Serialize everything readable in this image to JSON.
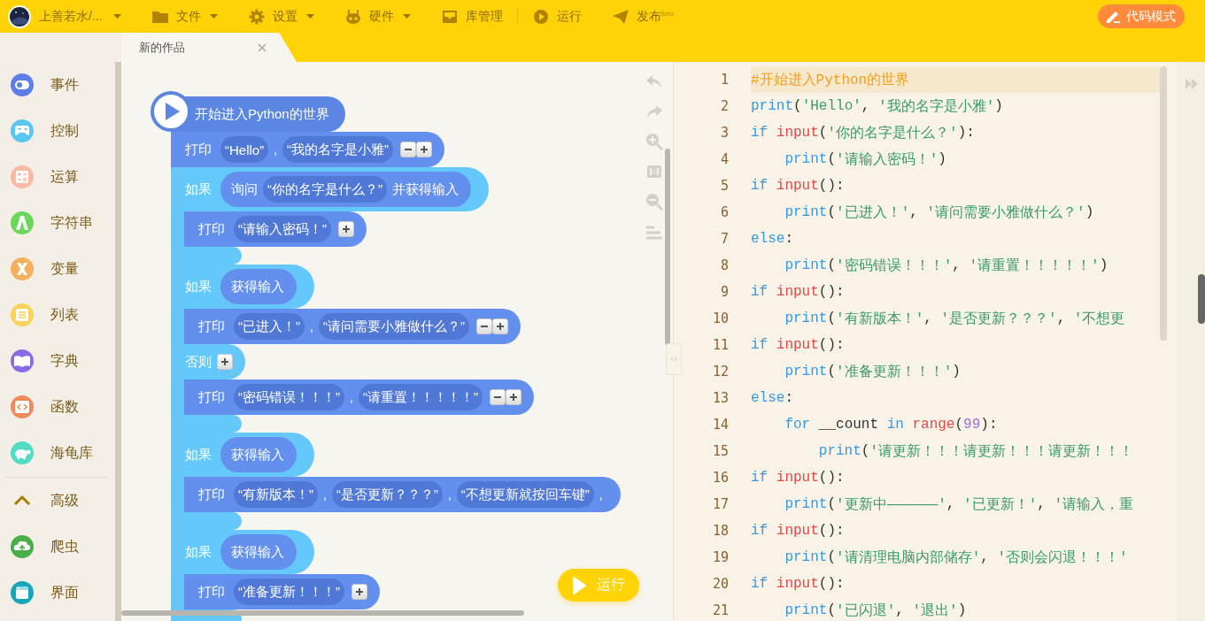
{
  "topbar": {
    "account": {
      "name": "上善若水/...",
      "has_menu": true
    },
    "menus": [
      {
        "label": "文件",
        "has_menu": true
      },
      {
        "label": "设置",
        "has_menu": true
      },
      {
        "label": "硬件",
        "has_menu": true
      },
      {
        "label": "库管理",
        "has_menu": false
      },
      {
        "label": "运行",
        "has_menu": false
      },
      {
        "label": "发布",
        "has_menu": false,
        "badge": "Beta"
      }
    ],
    "mode_button": "代码模式"
  },
  "tabs": [
    {
      "label": "新的作品",
      "selected": true
    }
  ],
  "sidebar": {
    "items": [
      {
        "label": "事件",
        "color": "#5b7fe6"
      },
      {
        "label": "控制",
        "color": "#5cc6f2"
      },
      {
        "label": "运算",
        "color": "#f9b9a2"
      },
      {
        "label": "字符串",
        "color": "#6cd85a"
      },
      {
        "label": "变量",
        "color": "#f4b05c"
      },
      {
        "label": "列表",
        "color": "#fbd25c"
      },
      {
        "label": "字典",
        "color": "#8a6be6"
      },
      {
        "label": "函数",
        "color": "#f0895a"
      },
      {
        "label": "海龟库",
        "color": "#4fdcc2"
      },
      {
        "label": "高级",
        "color": "#a67c00"
      },
      {
        "label": "爬虫",
        "color": "#4aae48"
      },
      {
        "label": "界面",
        "color": "#13a7b8"
      }
    ]
  },
  "blocks": {
    "start": "开始进入Python的世界",
    "stack": [
      {
        "kind": "print",
        "keyword": "打印",
        "args": [
          {
            "kind": "string",
            "text": "“Hello”"
          },
          {
            "kind": "sep",
            "text": ","
          },
          {
            "kind": "string",
            "text": "“我的名字是小雅”"
          }
        ],
        "can_remove": true,
        "can_add": true
      },
      {
        "kind": "if",
        "keyword": "如果",
        "condition": [
          {
            "kind": "label",
            "text": "询问"
          },
          {
            "kind": "string",
            "text": "“你的名字是什么？”"
          },
          {
            "kind": "label",
            "text": "并获得输入"
          }
        ],
        "body": [
          {
            "kind": "print",
            "keyword": "打印",
            "args": [
              {
                "kind": "string",
                "text": "“请输入密码！”"
              }
            ],
            "can_remove": false,
            "can_add": true
          }
        ]
      },
      {
        "kind": "if",
        "keyword": "如果",
        "condition": [
          {
            "kind": "label",
            "text": "获得输入"
          }
        ],
        "body": [
          {
            "kind": "print",
            "keyword": "打印",
            "args": [
              {
                "kind": "string",
                "text": "“已进入！”"
              },
              {
                "kind": "sep",
                "text": ","
              },
              {
                "kind": "string",
                "text": "“请问需要小雅做什么？”"
              }
            ],
            "can_remove": true,
            "can_add": true
          }
        ],
        "else": {
          "keyword": "否则",
          "can_add": true,
          "body": [
            {
              "kind": "print",
              "keyword": "打印",
              "args": [
                {
                  "kind": "string",
                  "text": "“密码错误！！！”"
                },
                {
                  "kind": "sep",
                  "text": ","
                },
                {
                  "kind": "string",
                  "text": "“请重置！！！！！”"
                }
              ],
              "can_remove": true,
              "can_add": true
            }
          ]
        }
      },
      {
        "kind": "if",
        "keyword": "如果",
        "condition": [
          {
            "kind": "label",
            "text": "获得输入"
          }
        ],
        "body": [
          {
            "kind": "print",
            "keyword": "打印",
            "args": [
              {
                "kind": "string",
                "text": "“有新版本！”"
              },
              {
                "kind": "sep",
                "text": ","
              },
              {
                "kind": "string",
                "text": "“是否更新？？？”"
              },
              {
                "kind": "sep",
                "text": ","
              },
              {
                "kind": "string",
                "text": "“不想更新就按回车键”"
              },
              {
                "kind": "sep",
                "text": ","
              }
            ],
            "can_remove": false,
            "can_add": false
          }
        ]
      },
      {
        "kind": "if",
        "keyword": "如果",
        "condition": [
          {
            "kind": "label",
            "text": "获得输入"
          }
        ],
        "body": [
          {
            "kind": "print",
            "keyword": "打印",
            "args": [
              {
                "kind": "string",
                "text": "“准备更新！！！”"
              }
            ],
            "can_remove": false,
            "can_add": true
          }
        ]
      }
    ],
    "run_button": "运行"
  },
  "code": {
    "lines": [
      {
        "number": "1",
        "current": true,
        "tokens": [
          {
            "kind": "comment",
            "text": "#开始进入Python的世界"
          }
        ]
      },
      {
        "number": "2",
        "current": false,
        "tokens": [
          {
            "kind": "keyword",
            "text": "print"
          },
          {
            "kind": "plain",
            "text": "("
          },
          {
            "kind": "string",
            "text": "'Hello'"
          },
          {
            "kind": "plain",
            "text": ", "
          },
          {
            "kind": "string",
            "text": "'我的名字是小雅'"
          },
          {
            "kind": "plain",
            "text": ")"
          }
        ]
      },
      {
        "number": "3",
        "current": false,
        "tokens": [
          {
            "kind": "keyword",
            "text": "if "
          },
          {
            "kind": "builtin",
            "text": "input"
          },
          {
            "kind": "plain",
            "text": "("
          },
          {
            "kind": "string",
            "text": "'你的名字是什么？'"
          },
          {
            "kind": "plain",
            "text": "):"
          }
        ]
      },
      {
        "number": "4",
        "current": false,
        "tokens": [
          {
            "kind": "keyword",
            "text": "    print"
          },
          {
            "kind": "plain",
            "text": "("
          },
          {
            "kind": "string",
            "text": "'请输入密码！'"
          },
          {
            "kind": "plain",
            "text": ")"
          }
        ]
      },
      {
        "number": "5",
        "current": false,
        "tokens": [
          {
            "kind": "keyword",
            "text": "if "
          },
          {
            "kind": "builtin",
            "text": "input"
          },
          {
            "kind": "plain",
            "text": "():"
          }
        ]
      },
      {
        "number": "6",
        "current": false,
        "tokens": [
          {
            "kind": "keyword",
            "text": "    print"
          },
          {
            "kind": "plain",
            "text": "("
          },
          {
            "kind": "string",
            "text": "'已进入！'"
          },
          {
            "kind": "plain",
            "text": ", "
          },
          {
            "kind": "string",
            "text": "'请问需要小雅做什么？'"
          },
          {
            "kind": "plain",
            "text": ")"
          }
        ]
      },
      {
        "number": "7",
        "current": false,
        "tokens": [
          {
            "kind": "keyword",
            "text": "else"
          },
          {
            "kind": "plain",
            "text": ":"
          }
        ]
      },
      {
        "number": "8",
        "current": false,
        "tokens": [
          {
            "kind": "keyword",
            "text": "    print"
          },
          {
            "kind": "plain",
            "text": "("
          },
          {
            "kind": "string",
            "text": "'密码错误！！！'"
          },
          {
            "kind": "plain",
            "text": ", "
          },
          {
            "kind": "string",
            "text": "'请重置！！！！！'"
          },
          {
            "kind": "plain",
            "text": ")"
          }
        ]
      },
      {
        "number": "9",
        "current": false,
        "tokens": [
          {
            "kind": "keyword",
            "text": "if "
          },
          {
            "kind": "builtin",
            "text": "input"
          },
          {
            "kind": "plain",
            "text": "():"
          }
        ]
      },
      {
        "number": "10",
        "current": false,
        "tokens": [
          {
            "kind": "keyword",
            "text": "    print"
          },
          {
            "kind": "plain",
            "text": "("
          },
          {
            "kind": "string",
            "text": "'有新版本！'"
          },
          {
            "kind": "plain",
            "text": ", "
          },
          {
            "kind": "string",
            "text": "'是否更新？？？'"
          },
          {
            "kind": "plain",
            "text": ", "
          },
          {
            "kind": "string",
            "text": "'不想更"
          }
        ]
      },
      {
        "number": "11",
        "current": false,
        "tokens": [
          {
            "kind": "keyword",
            "text": "if "
          },
          {
            "kind": "builtin",
            "text": "input"
          },
          {
            "kind": "plain",
            "text": "():"
          }
        ]
      },
      {
        "number": "12",
        "current": false,
        "tokens": [
          {
            "kind": "keyword",
            "text": "    print"
          },
          {
            "kind": "plain",
            "text": "("
          },
          {
            "kind": "string",
            "text": "'准备更新！！！'"
          },
          {
            "kind": "plain",
            "text": ")"
          }
        ]
      },
      {
        "number": "13",
        "current": false,
        "tokens": [
          {
            "kind": "keyword",
            "text": "else"
          },
          {
            "kind": "plain",
            "text": ":"
          }
        ]
      },
      {
        "number": "14",
        "current": false,
        "tokens": [
          {
            "kind": "keyword",
            "text": "    for"
          },
          {
            "kind": "plain",
            "text": " __count "
          },
          {
            "kind": "keyword",
            "text": "in "
          },
          {
            "kind": "builtin",
            "text": "range"
          },
          {
            "kind": "plain",
            "text": "("
          },
          {
            "kind": "number",
            "text": "99"
          },
          {
            "kind": "plain",
            "text": "):"
          }
        ]
      },
      {
        "number": "15",
        "current": false,
        "tokens": [
          {
            "kind": "keyword",
            "text": "        print"
          },
          {
            "kind": "plain",
            "text": "("
          },
          {
            "kind": "string",
            "text": "'请更新！！！请更新！！！请更新！！！"
          }
        ]
      },
      {
        "number": "16",
        "current": false,
        "tokens": [
          {
            "kind": "keyword",
            "text": "if "
          },
          {
            "kind": "builtin",
            "text": "input"
          },
          {
            "kind": "plain",
            "text": "():"
          }
        ]
      },
      {
        "number": "17",
        "current": false,
        "tokens": [
          {
            "kind": "keyword",
            "text": "    print"
          },
          {
            "kind": "plain",
            "text": "("
          },
          {
            "kind": "string",
            "text": "'更新中——————'"
          },
          {
            "kind": "plain",
            "text": ", "
          },
          {
            "kind": "string",
            "text": "'已更新！'"
          },
          {
            "kind": "plain",
            "text": ", "
          },
          {
            "kind": "string",
            "text": "'请输入，重"
          }
        ]
      },
      {
        "number": "18",
        "current": false,
        "tokens": [
          {
            "kind": "keyword",
            "text": "if "
          },
          {
            "kind": "builtin",
            "text": "input"
          },
          {
            "kind": "plain",
            "text": "():"
          }
        ]
      },
      {
        "number": "19",
        "current": false,
        "tokens": [
          {
            "kind": "keyword",
            "text": "    print"
          },
          {
            "kind": "plain",
            "text": "("
          },
          {
            "kind": "string",
            "text": "'请清理电脑内部储存'"
          },
          {
            "kind": "plain",
            "text": ", "
          },
          {
            "kind": "string",
            "text": "'否则会闪退！！！'"
          }
        ]
      },
      {
        "number": "20",
        "current": false,
        "tokens": [
          {
            "kind": "keyword",
            "text": "if "
          },
          {
            "kind": "builtin",
            "text": "input"
          },
          {
            "kind": "plain",
            "text": "():"
          }
        ]
      },
      {
        "number": "21",
        "current": false,
        "tokens": [
          {
            "kind": "keyword",
            "text": "    print"
          },
          {
            "kind": "plain",
            "text": "("
          },
          {
            "kind": "string",
            "text": "'已闪退'"
          },
          {
            "kind": "plain",
            "text": ", "
          },
          {
            "kind": "string",
            "text": "'退出'"
          },
          {
            "kind": "plain",
            "text": ")"
          }
        ]
      }
    ]
  }
}
